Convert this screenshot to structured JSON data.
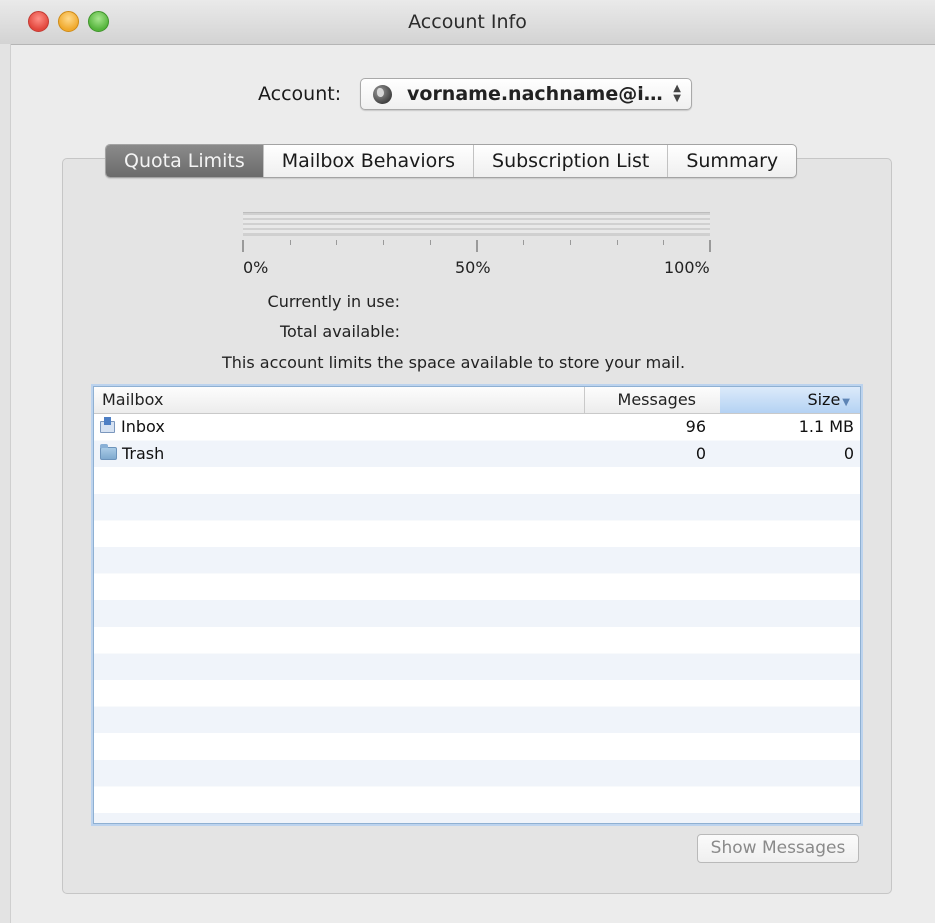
{
  "window": {
    "title": "Account Info"
  },
  "account": {
    "label": "Account:",
    "value": "vorname.nachname@i…",
    "arrows_up": "▲",
    "arrows_down": "▼"
  },
  "tabs": [
    {
      "label": "Quota Limits",
      "selected": true
    },
    {
      "label": "Mailbox Behaviors",
      "selected": false
    },
    {
      "label": "Subscription List",
      "selected": false
    },
    {
      "label": "Summary",
      "selected": false
    }
  ],
  "quota": {
    "usage_fraction": 0,
    "scale": {
      "low": "0%",
      "mid": "50%",
      "high": "100%"
    },
    "in_use_label": "Currently in use:",
    "available_label": "Total available:",
    "notice": "This account limits the space available to store your mail."
  },
  "table": {
    "columns": {
      "mailbox": "Mailbox",
      "messages": "Messages",
      "size": "Size",
      "sort_indicator": "▼"
    },
    "rows": [
      {
        "icon": "inbox-icon",
        "mailbox": "Inbox",
        "messages": "96",
        "size": "1.1 MB"
      },
      {
        "icon": "folder-icon",
        "mailbox": "Trash",
        "messages": "0",
        "size": "0"
      }
    ]
  },
  "buttons": {
    "show_messages": "Show Messages"
  },
  "colors": {
    "selected_tab": "#777777",
    "sorted_column": "#b4d2f3",
    "table_focus": "#8fb0d2"
  }
}
